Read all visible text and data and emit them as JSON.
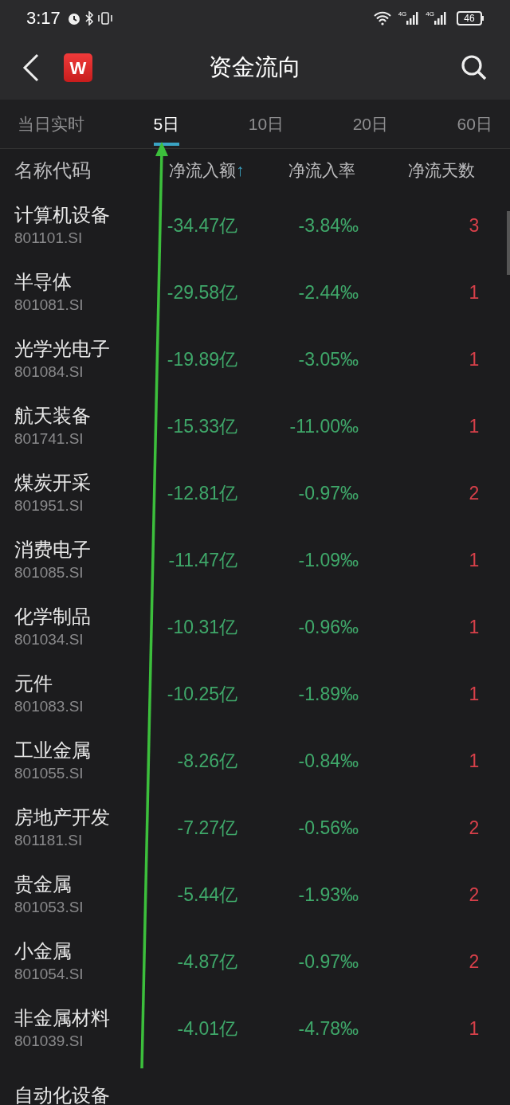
{
  "status_bar": {
    "time": "3:17",
    "networks": [
      "4G",
      "4G"
    ],
    "battery": "46"
  },
  "header": {
    "title": "资金流向",
    "logo": "W"
  },
  "tabs": [
    {
      "label": "当日实时",
      "selected": false
    },
    {
      "label": "5日",
      "selected": true
    },
    {
      "label": "10日",
      "selected": false
    },
    {
      "label": "20日",
      "selected": false
    },
    {
      "label": "60日",
      "selected": false
    }
  ],
  "table": {
    "columns": [
      {
        "label": "名称代码"
      },
      {
        "label": "净流入额",
        "sort": "↑"
      },
      {
        "label": "净流入率"
      },
      {
        "label": "净流天数"
      }
    ],
    "rows": [
      {
        "name": "计算机设备",
        "code": "801101.SI",
        "amount": "-34.47亿",
        "rate": "-3.84‰",
        "days": "3"
      },
      {
        "name": "半导体",
        "code": "801081.SI",
        "amount": "-29.58亿",
        "rate": "-2.44‰",
        "days": "1"
      },
      {
        "name": "光学光电子",
        "code": "801084.SI",
        "amount": "-19.89亿",
        "rate": "-3.05‰",
        "days": "1"
      },
      {
        "name": "航天装备",
        "code": "801741.SI",
        "amount": "-15.33亿",
        "rate": "-11.00‰",
        "days": "1"
      },
      {
        "name": "煤炭开采",
        "code": "801951.SI",
        "amount": "-12.81亿",
        "rate": "-0.97‰",
        "days": "2"
      },
      {
        "name": "消费电子",
        "code": "801085.SI",
        "amount": "-11.47亿",
        "rate": "-1.09‰",
        "days": "1"
      },
      {
        "name": "化学制品",
        "code": "801034.SI",
        "amount": "-10.31亿",
        "rate": "-0.96‰",
        "days": "1"
      },
      {
        "name": "元件",
        "code": "801083.SI",
        "amount": "-10.25亿",
        "rate": "-1.89‰",
        "days": "1"
      },
      {
        "name": "工业金属",
        "code": "801055.SI",
        "amount": "-8.26亿",
        "rate": "-0.84‰",
        "days": "1"
      },
      {
        "name": "房地产开发",
        "code": "801181.SI",
        "amount": "-7.27亿",
        "rate": "-0.56‰",
        "days": "2"
      },
      {
        "name": "贵金属",
        "code": "801053.SI",
        "amount": "-5.44亿",
        "rate": "-1.93‰",
        "days": "2"
      },
      {
        "name": "小金属",
        "code": "801054.SI",
        "amount": "-4.87亿",
        "rate": "-0.97‰",
        "days": "2"
      },
      {
        "name": "非金属材料",
        "code": "801039.SI",
        "amount": "-4.01亿",
        "rate": "-4.78‰",
        "days": "1"
      },
      {
        "name": "自动化设备"
      }
    ]
  }
}
